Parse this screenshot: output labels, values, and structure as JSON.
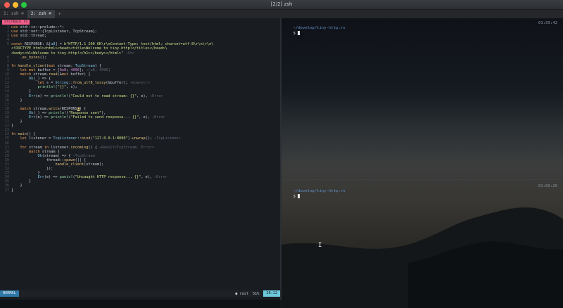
{
  "window": {
    "title": "[2/2] zsh"
  },
  "tabs": [
    {
      "label": "1: zsh ⌘"
    },
    {
      "label": "2: zsh ⌘"
    },
    {
      "label": "+"
    }
  ],
  "editor": {
    "file_label": "src/main.rs",
    "status": {
      "mode": "NORMAL",
      "filetype": "● rust",
      "percent": "51%",
      "position": "28:12"
    }
  },
  "terminal_top": {
    "path": "~/develop/tiny-http.rs",
    "prompt": "$",
    "time": "01:59:42"
  },
  "terminal_bottom": {
    "path": "~/develop/tiny-http.rs",
    "prompt": "$",
    "time": "01:59:25"
  },
  "code_lines": [
    {
      "n": "1",
      "html": "<span class='kw'>use</span> std::io::prelude::*;"
    },
    {
      "n": "2",
      "html": "<span class='kw'>use</span> std::net::{TcpListener, TcpStream};"
    },
    {
      "n": "3",
      "html": "<span class='kw'>use</span> std::thread;"
    },
    {
      "n": "4",
      "html": ""
    },
    {
      "n": "5",
      "html": "<span class='kw'>const</span> RESPONSE: &amp;[<span class='ty'>u8</span>] = <span class='st'>b\"HTTP/1.1 200 OK\\r\\nContent-Type: text/html; charset=utf-8\\r\\n\\r\\n\\</span>"
    },
    {
      "n": "",
      "html": "<span class='st'>&lt;!DOCTYPE html&gt;&lt;html&gt;&lt;head&gt;&lt;title&gt;Welcome to tiny-http!&lt;/title&gt;&lt;/head&gt;\\</span>"
    },
    {
      "n": "",
      "html": "<span class='st'>&lt;body&gt;&lt;h1&gt;Welcome to tiny-http!&lt;/h1&gt;&lt;/body&gt;&lt;/html&gt;\"</span> <span class='hint'>→Str</span>"
    },
    {
      "n": "6",
      "html": "    .<span class='fn'>as_bytes</span>();"
    },
    {
      "n": "7",
      "html": ""
    },
    {
      "n": "8",
      "html": "<span class='kw'>fn</span> <span class='fn'>handle_client</span>(<span class='kw'>mut</span> stream: <span class='ty'>TcpStream</span>) {"
    },
    {
      "n": "9",
      "html": "    <span class='kw'>let mut</span> buffer = [<span class='nm'>0u8</span>; <span class='nm'>4096</span>]; <span class='hint'>→[u8; 4096]</span>"
    },
    {
      "n": "10",
      "html": "    <span class='kw'>match</span> stream.<span class='fn'>read</span>(&amp;<span class='kw'>mut</span> buffer) {"
    },
    {
      "n": "11",
      "html": "        <span class='ty'>Ok</span>(_) =&gt; {"
    },
    {
      "n": "12",
      "html": "            <span class='kw'>let</span> s = <span class='ty'>String</span>::<span class='fn'>from_utf8_lossy</span>(&amp;buffer); <span class='hint'>→Cow&lt;str&gt;</span>"
    },
    {
      "n": "13",
      "html": "            <span class='mc'>println!</span>(<span class='st'>\"{}\"</span>, s);"
    },
    {
      "n": "14",
      "html": "        }"
    },
    {
      "n": "15",
      "html": "        <span class='ty'>Err</span>(e) =&gt; <span class='mc'>println!</span>(<span class='st'>\"Could not to read stream: {}\"</span>, e), <span class='hint'>→Error</span>"
    },
    {
      "n": "16",
      "html": "    }"
    },
    {
      "n": "17",
      "html": ""
    },
    {
      "n": "18",
      "html": "    <span class='kw'>match</span> stream.<span class='fn'>write</span>(RESPONS<span class='cursor-cell'>E</span>) {"
    },
    {
      "n": "19",
      "html": "        <span class='ty'>Ok</span>(_) =&gt; <span class='mc'>println!</span>(<span class='st'>\"Response sent\"</span>),"
    },
    {
      "n": "20",
      "html": "        <span class='ty'>Err</span>(e) =&gt; <span class='mc'>println!</span>(<span class='st'>\"Failed to send response... {}\"</span>, e), <span class='hint'>→Error</span>"
    },
    {
      "n": "21",
      "html": "    }"
    },
    {
      "n": "22",
      "html": "}"
    },
    {
      "n": "23",
      "html": ""
    },
    {
      "n": "24",
      "html": "<span class='kw'>fn</span> <span class='fn'>main</span>() {"
    },
    {
      "n": "25",
      "html": "    <span class='kw'>let</span> listener = <span class='ty'>TcpListener</span>::<span class='fn'>bind</span>(<span class='st'>\"127.0.0.1:8080\"</span>).<span class='fn'>unwrap</span>(); <span class='hint'>→TcpListener</span>"
    },
    {
      "n": "26",
      "html": ""
    },
    {
      "n": "27",
      "html": "    <span class='kw'>for</span> stream <span class='kw'>in</span> listener.<span class='fn'>incoming</span>() { <span class='hint'>→Result&lt;TcpStream, Error&gt;</span>"
    },
    {
      "n": "28",
      "html": "        <span class='kw'>match</span> stream {"
    },
    {
      "n": "29",
      "html": "            <span class='ty'>Ok</span>(stream) =&gt; { <span class='hint'>→TcpStream</span>"
    },
    {
      "n": "30",
      "html": "                thread::<span class='fn'>spawn</span>(|| {"
    },
    {
      "n": "31",
      "html": "                    <span class='fn'>handle_client</span>(stream);"
    },
    {
      "n": "32",
      "html": "                });"
    },
    {
      "n": "33",
      "html": "            }"
    },
    {
      "n": "34",
      "html": "            <span class='ty'>Err</span>(e) =&gt; <span class='mc'>panic!</span>(<span class='st'>\"Uncaught HTTP response... {}\"</span>, e), <span class='hint'>→Error</span>"
    },
    {
      "n": "35",
      "html": "        }"
    },
    {
      "n": "36",
      "html": "    }"
    },
    {
      "n": "37",
      "html": "}"
    }
  ]
}
